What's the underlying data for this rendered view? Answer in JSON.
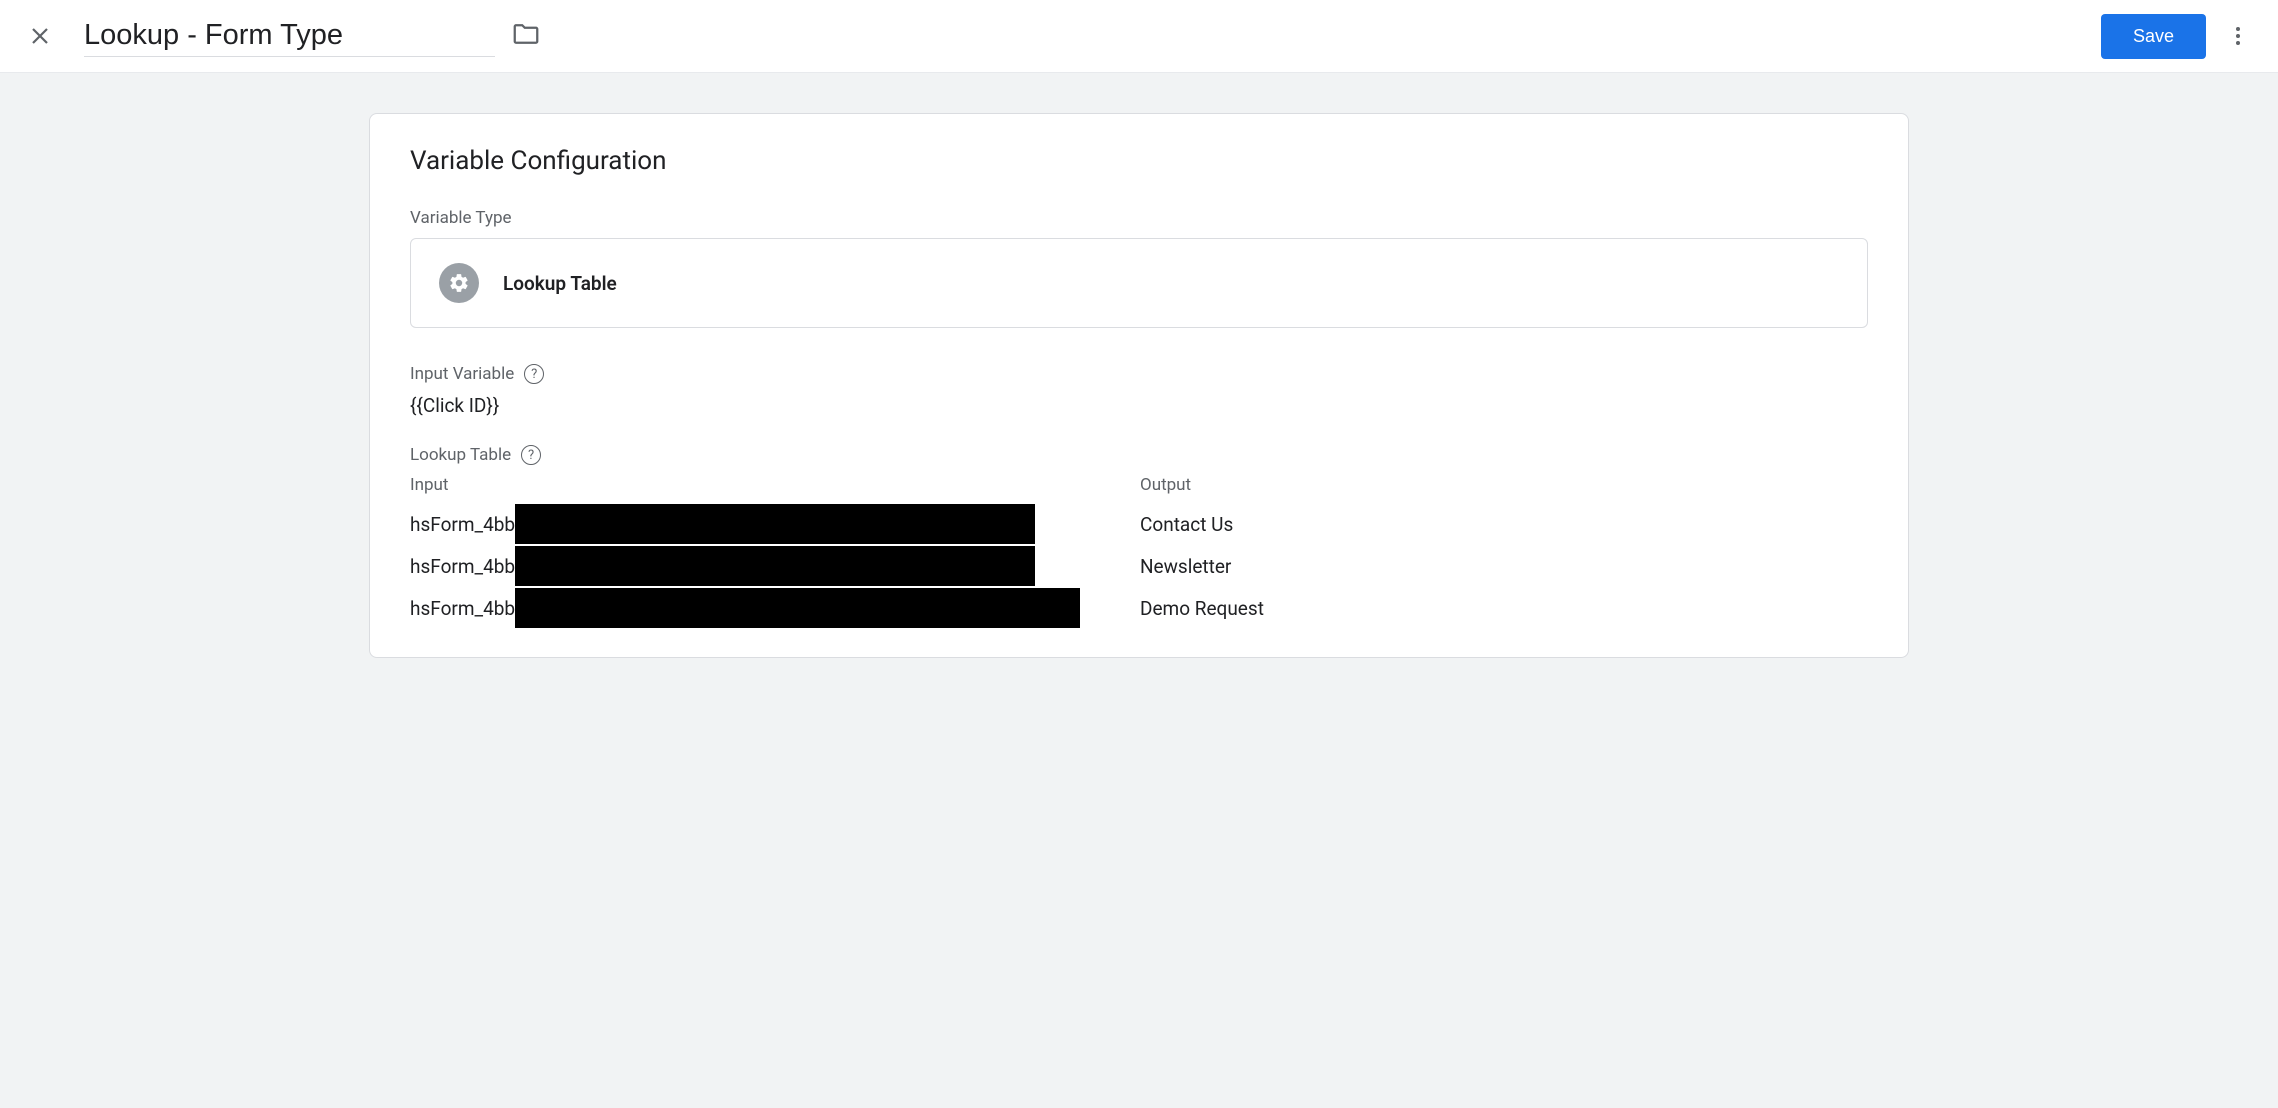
{
  "header": {
    "title": "Lookup - Form Type",
    "save_label": "Save"
  },
  "card": {
    "title": "Variable Configuration",
    "variable_type_label": "Variable Type",
    "variable_type_name": "Lookup Table",
    "input_variable_label": "Input Variable",
    "input_variable_value": "{{Click ID}}",
    "lookup_table_label": "Lookup Table",
    "columns": {
      "input": "Input",
      "output": "Output"
    },
    "rows": [
      {
        "input_prefix": "hsForm_4bb",
        "output": "Contact Us"
      },
      {
        "input_prefix": "hsForm_4bb",
        "output": "Newsletter"
      },
      {
        "input_prefix": "hsForm_4bb",
        "output": "Demo Request"
      }
    ]
  }
}
